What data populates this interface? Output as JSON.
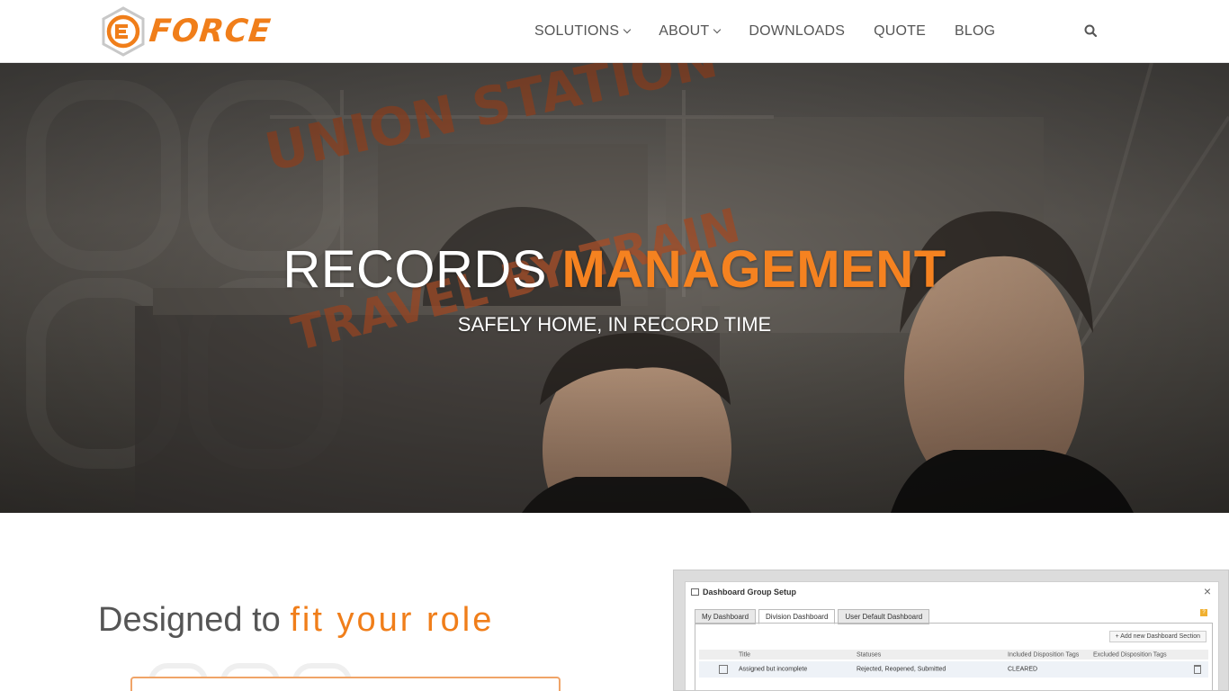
{
  "brand": {
    "logo_text": "FORCE",
    "logo_letter": "E",
    "accent_color": "#f07e1a"
  },
  "nav": {
    "items": [
      {
        "label": "SOLUTIONS",
        "has_dropdown": true
      },
      {
        "label": "ABOUT",
        "has_dropdown": true
      },
      {
        "label": "DOWNLOADS",
        "has_dropdown": false
      },
      {
        "label": "QUOTE",
        "has_dropdown": false
      },
      {
        "label": "BLOG",
        "has_dropdown": false
      }
    ],
    "search_icon": "search-icon"
  },
  "hero": {
    "title_plain": "RECORDS",
    "title_accent": "MANAGEMENT",
    "subtitle": "SAFELY HOME, IN RECORD TIME",
    "background_sign_top": "UNION STATION",
    "background_sign_bottom": "TRAVEL BY TRAIN"
  },
  "section": {
    "title_plain": "Designed to",
    "title_accent": "fit your role"
  },
  "screenshot": {
    "window_title": "Dashboard Group Setup",
    "tabs": [
      "My Dashboard",
      "Division Dashboard",
      "User Default Dashboard"
    ],
    "active_tab": 1,
    "add_button": "Add new Dashboard Section",
    "columns": [
      "Title",
      "Statuses",
      "Included Disposition Tags",
      "Excluded Disposition Tags"
    ],
    "rows": [
      {
        "title": "Assigned but incomplete",
        "statuses": "Rejected, Reopened, Submitted",
        "included": "CLEARED",
        "excluded": ""
      }
    ]
  }
}
